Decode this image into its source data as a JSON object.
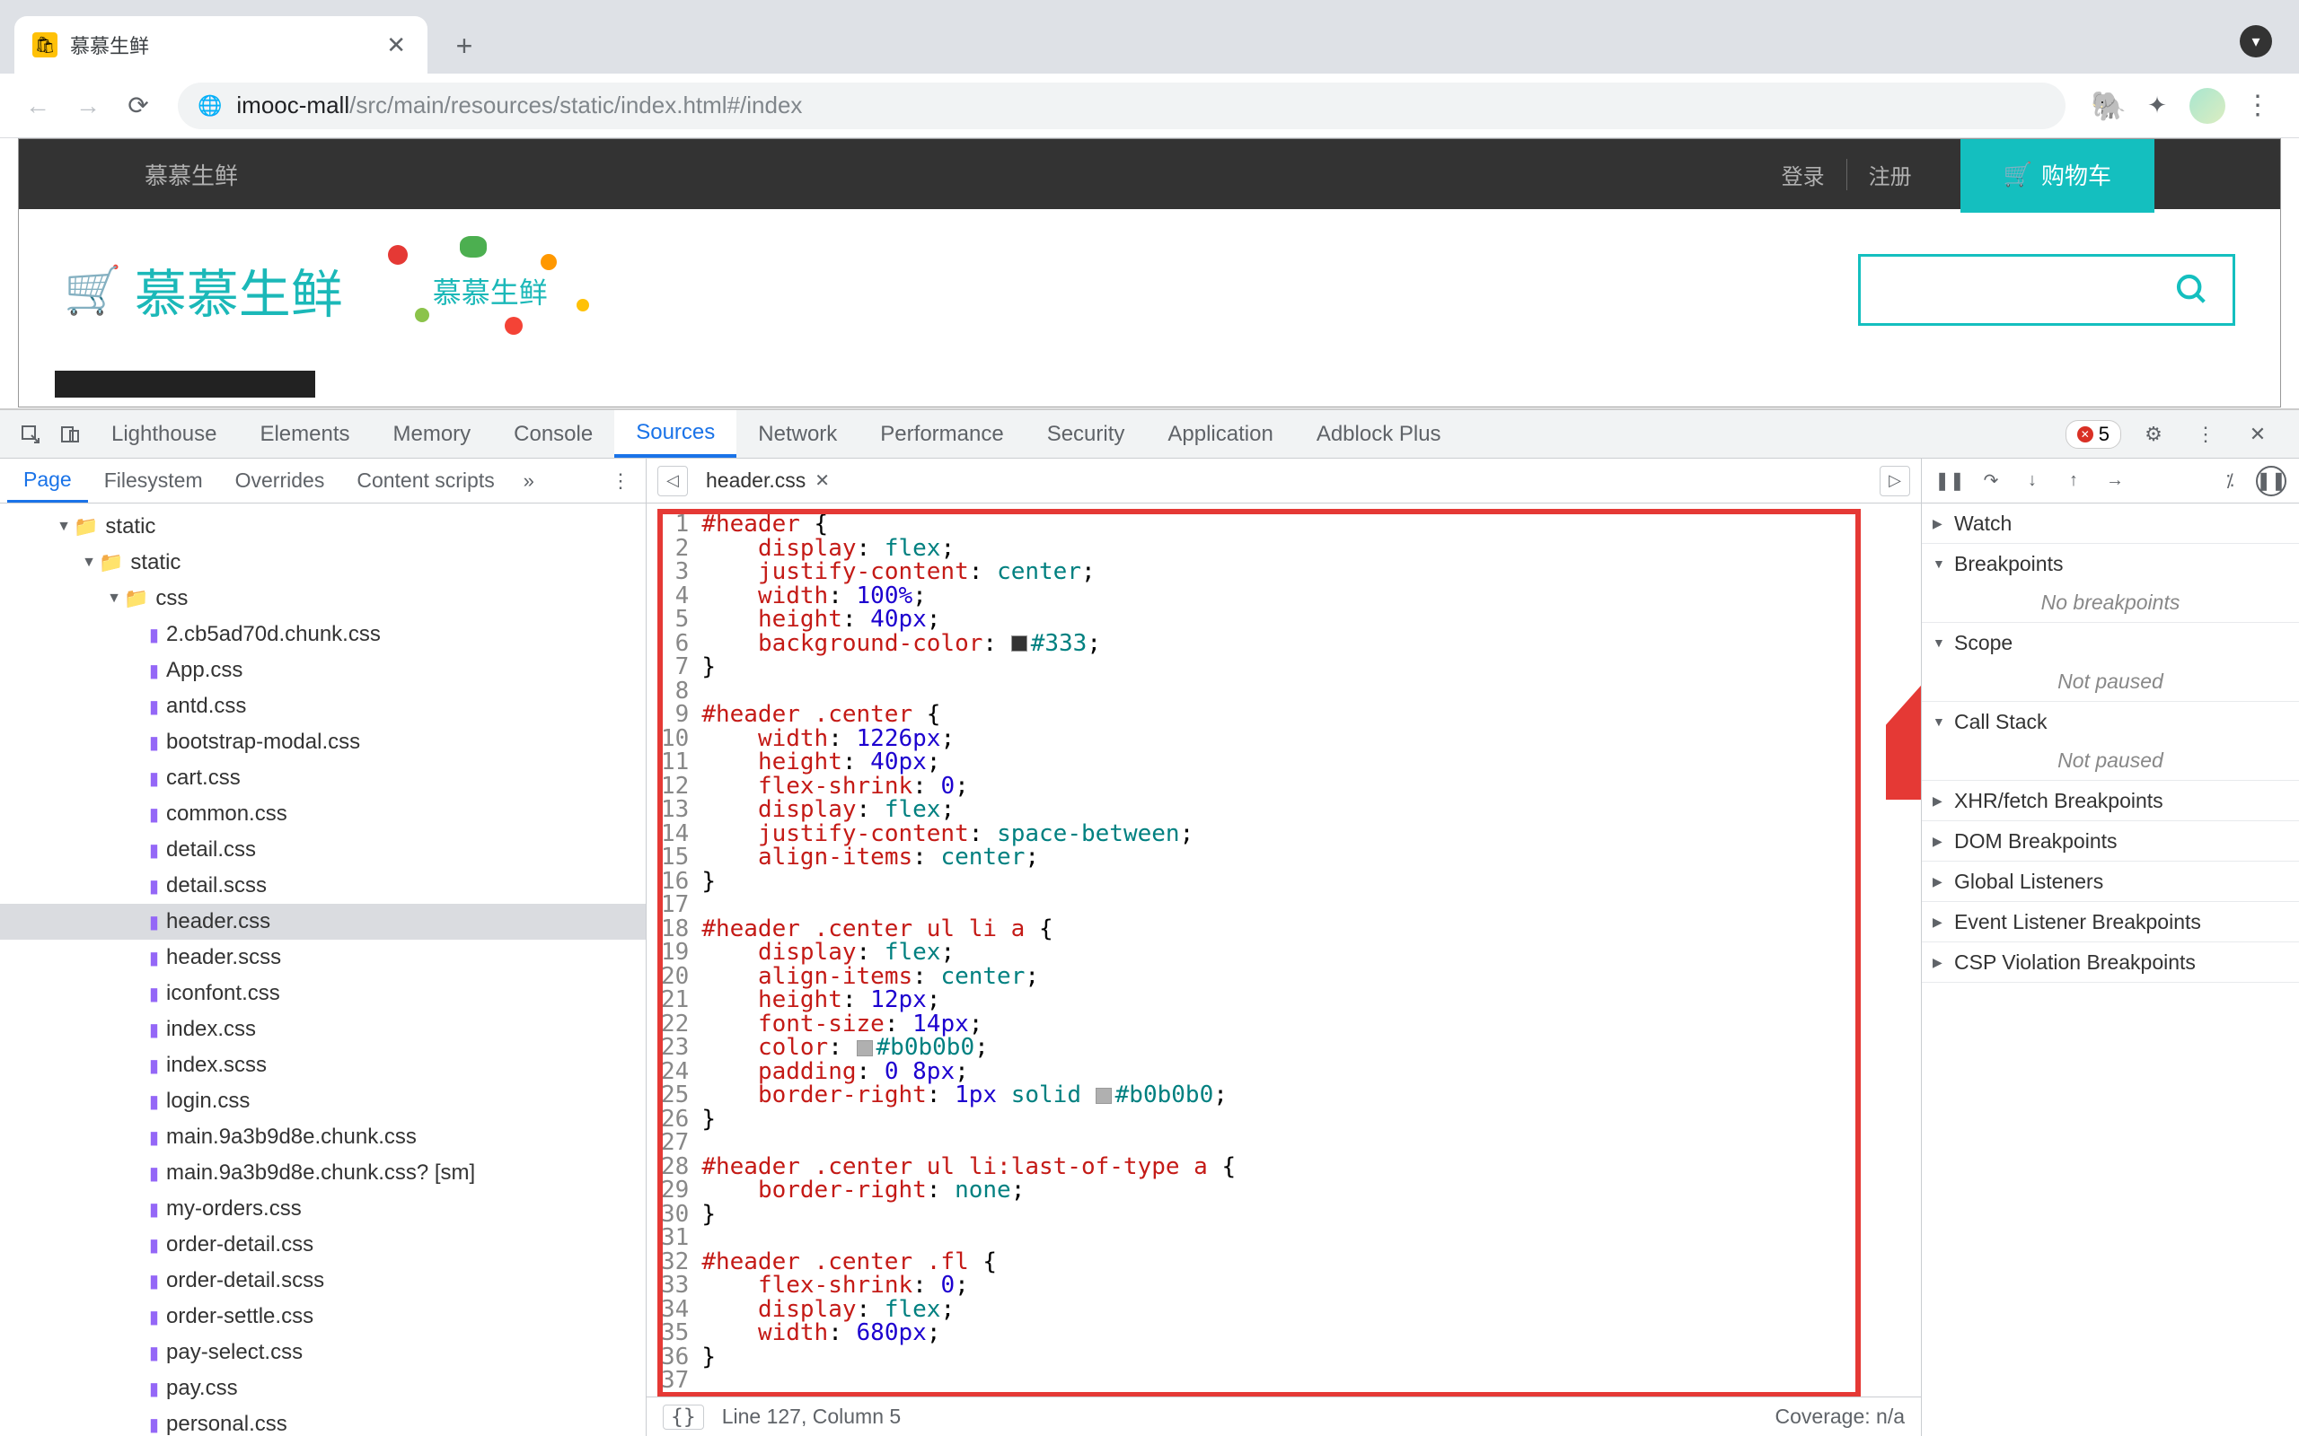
{
  "browser": {
    "tab_title": "慕慕生鲜",
    "address_host": "imooc-mall",
    "address_path": "/src/main/resources/static/index.html#/index"
  },
  "site": {
    "brand": "慕慕生鲜",
    "login": "登录",
    "register": "注册",
    "cart": "购物车",
    "logo_text": "慕慕生鲜",
    "deco_text": "慕慕生鲜"
  },
  "devtools": {
    "tabs": [
      "Lighthouse",
      "Elements",
      "Memory",
      "Console",
      "Sources",
      "Network",
      "Performance",
      "Security",
      "Application",
      "Adblock Plus"
    ],
    "active_tab": "Sources",
    "error_count": "5",
    "sources_nav_tabs": [
      "Page",
      "Filesystem",
      "Overrides",
      "Content scripts"
    ],
    "active_nav_tab": "Page",
    "file_tree": {
      "root": "static",
      "sub": "static",
      "folder": "css",
      "files": [
        "2.cb5ad70d.chunk.css",
        "App.css",
        "antd.css",
        "bootstrap-modal.css",
        "cart.css",
        "common.css",
        "detail.css",
        "detail.scss",
        "header.css",
        "header.scss",
        "iconfont.css",
        "index.css",
        "index.scss",
        "login.css",
        "main.9a3b9d8e.chunk.css",
        "main.9a3b9d8e.chunk.css? [sm]",
        "my-orders.css",
        "order-detail.css",
        "order-detail.scss",
        "order-settle.css",
        "pay-select.css",
        "pay.css",
        "personal.css"
      ],
      "selected": "header.css"
    },
    "open_file": "header.css",
    "status_line": "Line 127, Column 5",
    "coverage": "Coverage: n/a",
    "debugger_sections": {
      "watch": "Watch",
      "breakpoints": "Breakpoints",
      "breakpoints_body": "No breakpoints",
      "scope": "Scope",
      "scope_body": "Not paused",
      "callstack": "Call Stack",
      "callstack_body": "Not paused",
      "xhr": "XHR/fetch Breakpoints",
      "dom": "DOM Breakpoints",
      "global": "Global Listeners",
      "event": "Event Listener Breakpoints",
      "csp": "CSP Violation Breakpoints"
    },
    "code": [
      {
        "n": 1,
        "html": "<span class='sel'>#header</span> {"
      },
      {
        "n": 2,
        "html": "    <span class='prop'>display</span>: <span class='valkw'>flex</span>;"
      },
      {
        "n": 3,
        "html": "    <span class='prop'>justify-content</span>: <span class='valkw'>center</span>;"
      },
      {
        "n": 4,
        "html": "    <span class='prop'>width</span>: <span class='val'>100%</span>;"
      },
      {
        "n": 5,
        "html": "    <span class='prop'>height</span>: <span class='val'>40px</span>;"
      },
      {
        "n": 6,
        "html": "    <span class='prop'>background-color</span>: <span class='swatch' style='background:#333'></span><span class='hex'>#333</span>;"
      },
      {
        "n": 7,
        "html": "}"
      },
      {
        "n": 8,
        "html": ""
      },
      {
        "n": 9,
        "html": "<span class='sel'>#header .center</span> {"
      },
      {
        "n": 10,
        "html": "    <span class='prop'>width</span>: <span class='val'>1226px</span>;"
      },
      {
        "n": 11,
        "html": "    <span class='prop'>height</span>: <span class='val'>40px</span>;"
      },
      {
        "n": 12,
        "html": "    <span class='prop'>flex-shrink</span>: <span class='val'>0</span>;"
      },
      {
        "n": 13,
        "html": "    <span class='prop'>display</span>: <span class='valkw'>flex</span>;"
      },
      {
        "n": 14,
        "html": "    <span class='prop'>justify-content</span>: <span class='valkw'>space-between</span>;"
      },
      {
        "n": 15,
        "html": "    <span class='prop'>align-items</span>: <span class='valkw'>center</span>;"
      },
      {
        "n": 16,
        "html": "}"
      },
      {
        "n": 17,
        "html": ""
      },
      {
        "n": 18,
        "html": "<span class='sel'>#header .center ul li a</span> {"
      },
      {
        "n": 19,
        "html": "    <span class='prop'>display</span>: <span class='valkw'>flex</span>;"
      },
      {
        "n": 20,
        "html": "    <span class='prop'>align-items</span>: <span class='valkw'>center</span>;"
      },
      {
        "n": 21,
        "html": "    <span class='prop'>height</span>: <span class='val'>12px</span>;"
      },
      {
        "n": 22,
        "html": "    <span class='prop'>font-size</span>: <span class='val'>14px</span>;"
      },
      {
        "n": 23,
        "html": "    <span class='prop'>color</span>: <span class='swatch' style='background:#b0b0b0'></span><span class='hex'>#b0b0b0</span>;"
      },
      {
        "n": 24,
        "html": "    <span class='prop'>padding</span>: <span class='val'>0 8px</span>;"
      },
      {
        "n": 25,
        "html": "    <span class='prop'>border-right</span>: <span class='val'>1px</span> <span class='valkw'>solid</span> <span class='swatch' style='background:#b0b0b0'></span><span class='hex'>#b0b0b0</span>;"
      },
      {
        "n": 26,
        "html": "}"
      },
      {
        "n": 27,
        "html": ""
      },
      {
        "n": 28,
        "html": "<span class='sel'>#header .center ul li:last-of-type a</span> {"
      },
      {
        "n": 29,
        "html": "    <span class='prop'>border-right</span>: <span class='valkw'>none</span>;"
      },
      {
        "n": 30,
        "html": "}"
      },
      {
        "n": 31,
        "html": ""
      },
      {
        "n": 32,
        "html": "<span class='sel'>#header .center .fl</span> {"
      },
      {
        "n": 33,
        "html": "    <span class='prop'>flex-shrink</span>: <span class='val'>0</span>;"
      },
      {
        "n": 34,
        "html": "    <span class='prop'>display</span>: <span class='valkw'>flex</span>;"
      },
      {
        "n": 35,
        "html": "    <span class='prop'>width</span>: <span class='val'>680px</span>;"
      },
      {
        "n": 36,
        "html": "}"
      },
      {
        "n": 37,
        "html": ""
      }
    ]
  }
}
